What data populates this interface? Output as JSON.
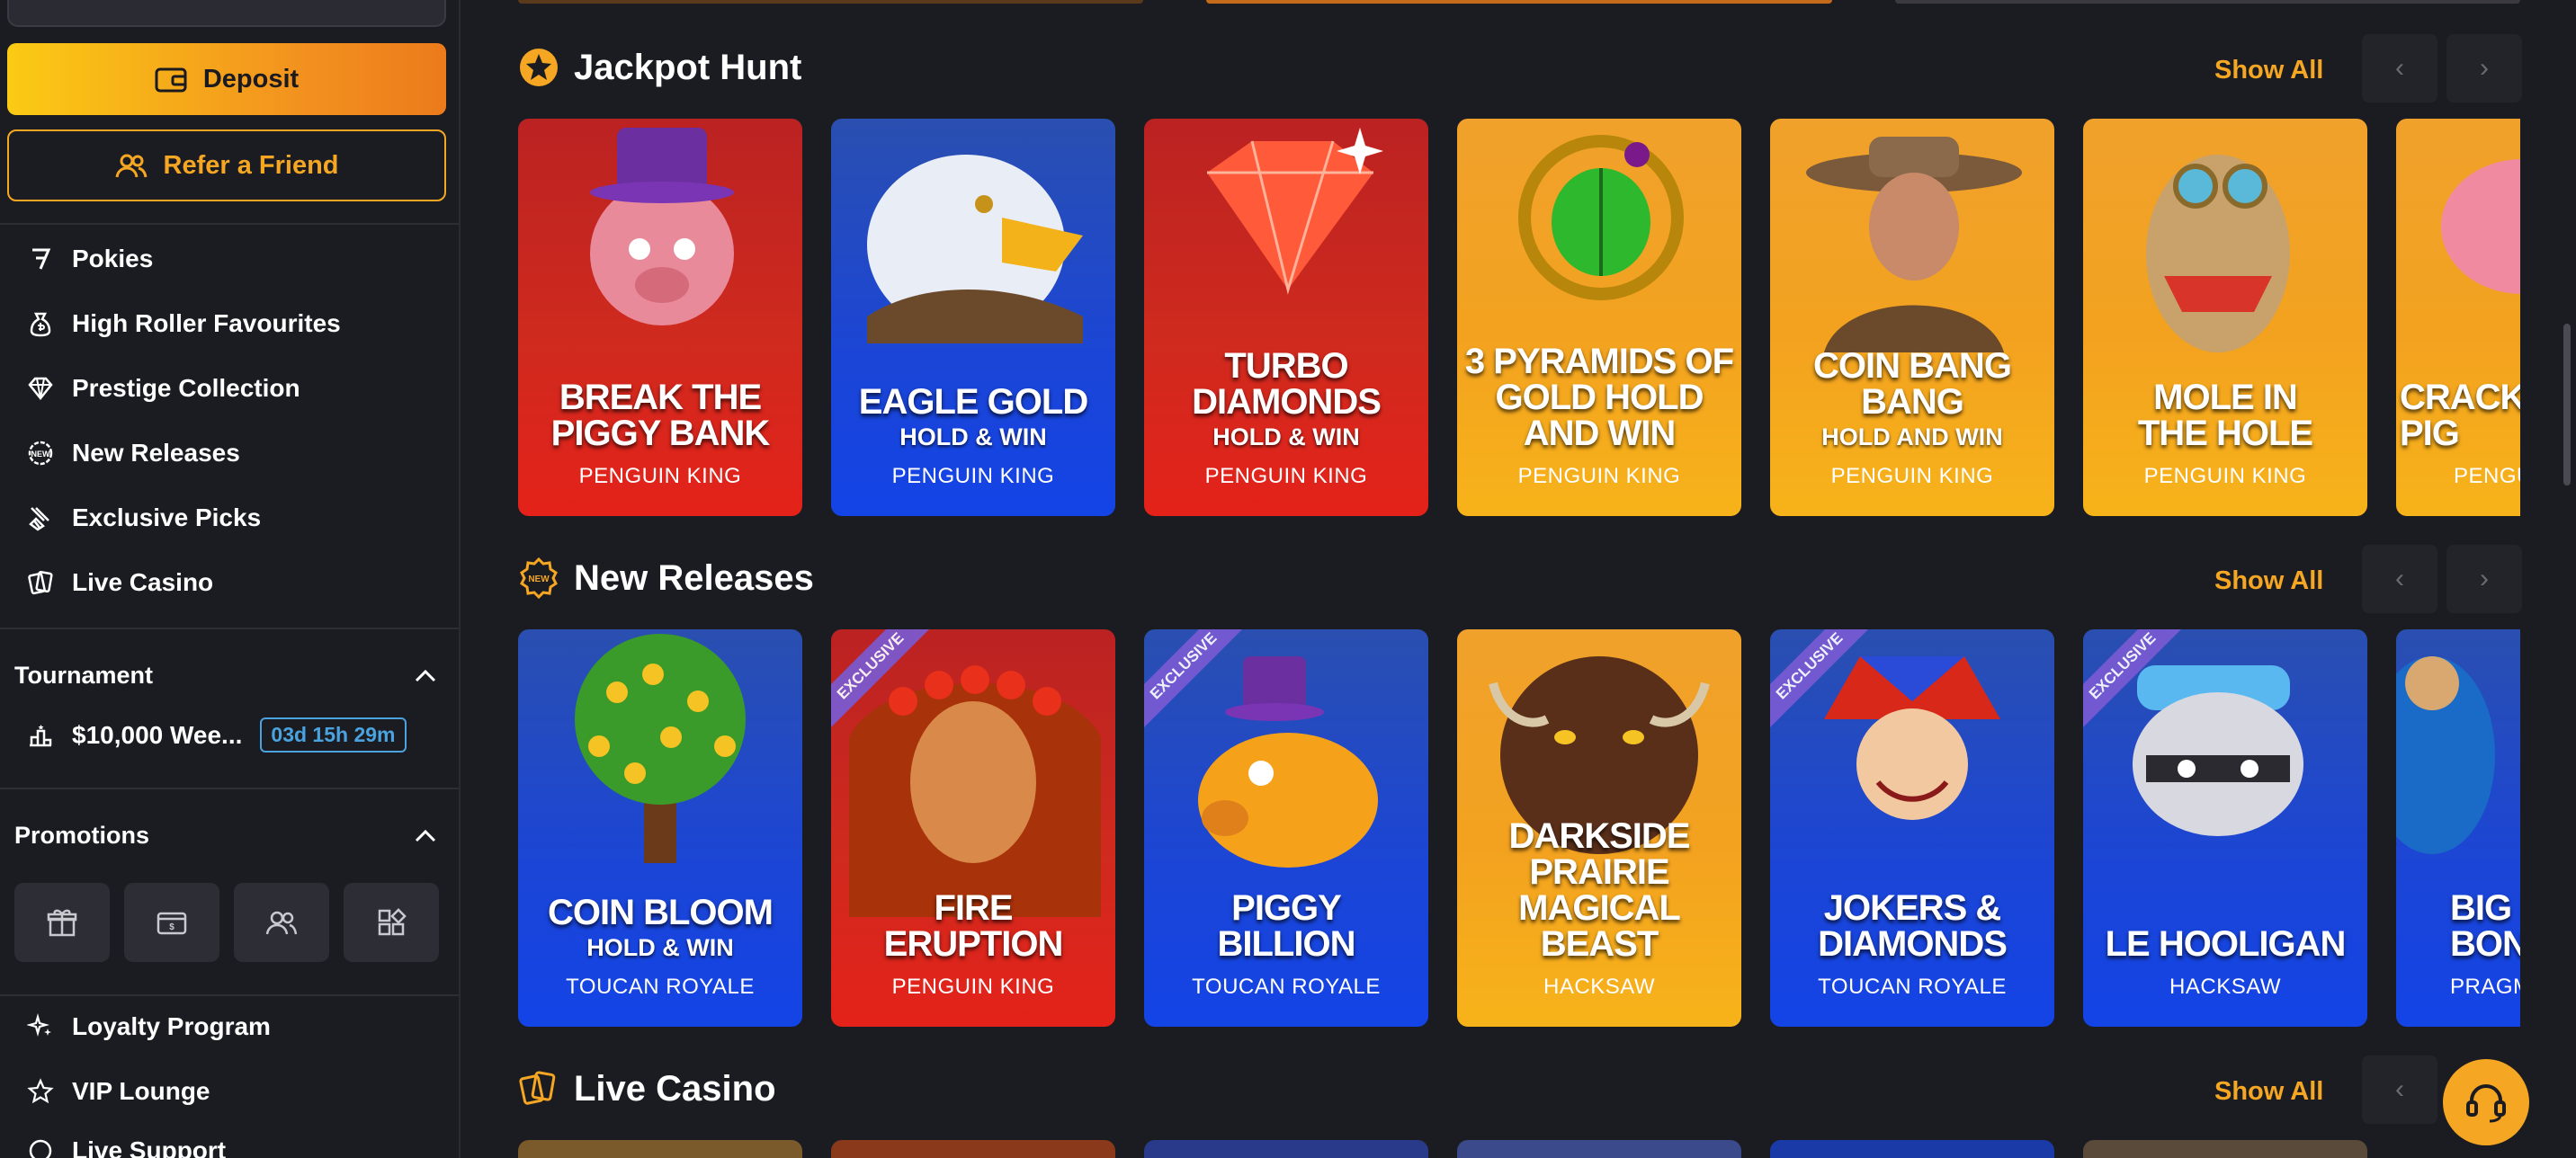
{
  "sidebar": {
    "deposit_label": "Deposit",
    "refer_label": "Refer a Friend",
    "nav_items": [
      {
        "label": "Pokies",
        "icon": "seven-icon"
      },
      {
        "label": "High Roller Favourites",
        "icon": "money-bag-icon"
      },
      {
        "label": "Prestige Collection",
        "icon": "diamond-icon"
      },
      {
        "label": "New Releases",
        "icon": "new-badge-icon"
      },
      {
        "label": "Exclusive Picks",
        "icon": "exclusive-icon"
      },
      {
        "label": "Live Casino",
        "icon": "cards-icon"
      }
    ],
    "tournament": {
      "heading": "Tournament",
      "item_label": "$10,000 Wee...",
      "timer": "03d 15h 29m"
    },
    "promotions": {
      "heading": "Promotions",
      "buttons": [
        "gift-icon",
        "wallet-icon",
        "users-icon",
        "grid-icon"
      ]
    },
    "bottom_items": [
      {
        "label": "Loyalty Program",
        "icon": "sparkle-icon"
      },
      {
        "label": "VIP Lounge",
        "icon": "star-icon"
      },
      {
        "label": "Live Support",
        "icon": "chat-icon"
      }
    ]
  },
  "sections": {
    "jackpot": {
      "title": "Jackpot Hunt",
      "show_all": "Show All",
      "cards": [
        {
          "title": "BREAK THE PIGGY BANK",
          "sub": "",
          "provider": "PENGUIN KING",
          "theme": "red"
        },
        {
          "title": "EAGLE GOLD",
          "sub": "HOLD & WIN",
          "provider": "PENGUIN KING",
          "theme": "blue"
        },
        {
          "title": "TURBO DIAMONDS",
          "sub": "HOLD & WIN",
          "provider": "PENGUIN KING",
          "theme": "red"
        },
        {
          "title": "3 PYRAMIDS OF GOLD HOLD AND WIN",
          "sub": "",
          "provider": "PENGUIN KING",
          "theme": "orange"
        },
        {
          "title": "COIN BANG BANG",
          "sub": "HOLD AND WIN",
          "provider": "PENGUIN KING",
          "theme": "orange"
        },
        {
          "title": "MOLE IN THE HOLE",
          "sub": "",
          "provider": "PENGUIN KING",
          "theme": "orange"
        },
        {
          "title": "CRACK THE PIG",
          "sub": "",
          "provider": "PENGUIN KING",
          "theme": "orange"
        }
      ]
    },
    "new_releases": {
      "title": "New Releases",
      "show_all": "Show All",
      "exclusive_label": "EXCLUSIVE",
      "cards": [
        {
          "title": "COIN BLOOM",
          "sub": "HOLD & WIN",
          "provider": "TOUCAN ROYALE",
          "theme": "blue",
          "exclusive": false
        },
        {
          "title": "FIRE ERUPTION",
          "sub": "",
          "provider": "PENGUIN KING",
          "theme": "red",
          "exclusive": true
        },
        {
          "title": "PIGGY BILLION",
          "sub": "",
          "provider": "TOUCAN ROYALE",
          "theme": "blue",
          "exclusive": true
        },
        {
          "title": "DARKSIDE PRAIRIE MAGICAL BEAST",
          "sub": "",
          "provider": "HACKSAW",
          "theme": "orange",
          "exclusive": false
        },
        {
          "title": "JOKERS & DIAMONDS",
          "sub": "",
          "provider": "TOUCAN ROYALE",
          "theme": "blue",
          "exclusive": true
        },
        {
          "title": "LE HOOLIGAN",
          "sub": "",
          "provider": "HACKSAW",
          "theme": "blue",
          "exclusive": true
        },
        {
          "title": "BIG FOOT BONUS",
          "sub": "",
          "provider": "PRAGMATIC",
          "theme": "blue",
          "exclusive": false
        }
      ]
    },
    "live_casino": {
      "title": "Live Casino",
      "show_all": "Show All"
    }
  },
  "support": {
    "icon": "headset-icon"
  },
  "colors": {
    "accent": "#f5a623",
    "background": "#1b1c21",
    "timer": "#4aa3df"
  }
}
